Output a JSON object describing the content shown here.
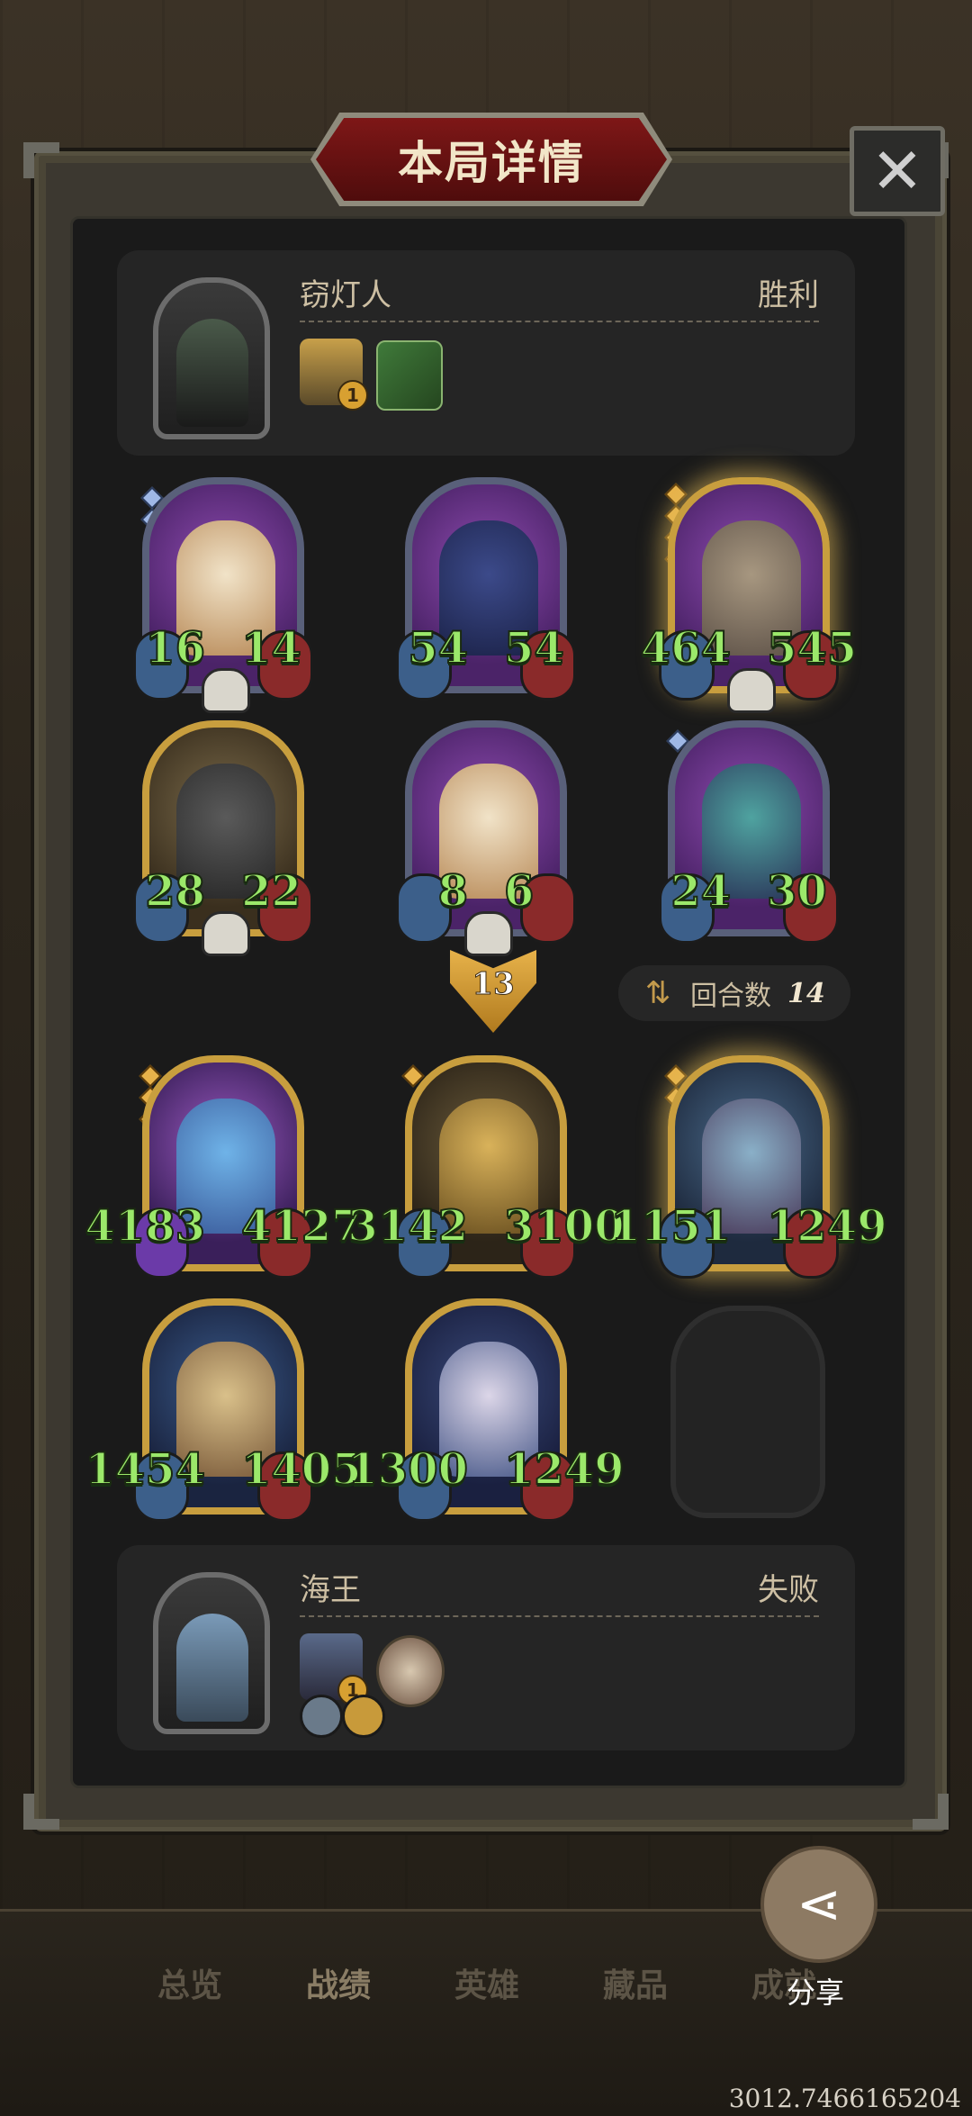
{
  "header": {
    "title": "本局详情",
    "close_icon": "close-icon"
  },
  "top_player": {
    "name": "窃灯人",
    "result": "胜利",
    "item_badge": "1"
  },
  "top_board": [
    {
      "attack": "16",
      "health": "14"
    },
    {
      "attack": "54",
      "health": "54"
    },
    {
      "attack": "464",
      "health": "545"
    },
    {
      "attack": "28",
      "health": "22"
    },
    {
      "attack": "8",
      "health": "6"
    },
    {
      "attack": "24",
      "health": "30"
    }
  ],
  "damage_marker": "13",
  "rounds": {
    "label": "回合数",
    "value": "14"
  },
  "bottom_board": [
    {
      "attack": "4183",
      "health": "4127"
    },
    {
      "attack": "3142",
      "health": "3100"
    },
    {
      "attack": "1151",
      "health": "1249"
    },
    {
      "attack": "1454",
      "health": "1405"
    },
    {
      "attack": "1300",
      "health": "1249"
    }
  ],
  "bottom_player": {
    "name": "海王",
    "result": "失败",
    "item_badge": "1"
  },
  "nav": {
    "tabs": [
      "总览",
      "战绩",
      "英雄",
      "藏品",
      "成就"
    ],
    "active": "战绩"
  },
  "share": {
    "label": "分享"
  },
  "footer_value": "3012.7466165204"
}
